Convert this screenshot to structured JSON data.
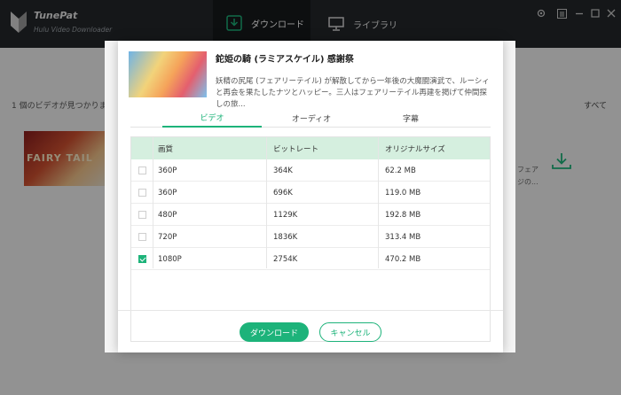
{
  "app": {
    "name": "TunePat",
    "subtitle": "Hulu Video Downloader"
  },
  "nav": {
    "download_label": "ダウンロード",
    "library_label": "ライブラリ"
  },
  "background": {
    "found_text": "1 個のビデオが見つかりま",
    "filter_label": "すべて",
    "thumb_text": "FAIRY TAIL",
    "snippet_line1": "フェア",
    "snippet_line2": "ジの..."
  },
  "modal": {
    "title": "鉈姫の騎 (ラミアスケイル) 感謝祭",
    "description": "妖精の尻尾 (フェアリーテイル) が解散してから一年後の大魔闘演武で、ルーシィと再会を果たしたナツとハッピー。三人はフェアリーテイル再建を掲げて仲間探しの旅...",
    "tabs": [
      {
        "label": "ビデオ",
        "active": true
      },
      {
        "label": "オーディオ",
        "active": false
      },
      {
        "label": "字幕",
        "active": false
      }
    ],
    "table": {
      "headers": [
        "画質",
        "ビットレート",
        "オリジナルサイズ"
      ],
      "rows": [
        {
          "quality": "360P",
          "bitrate": "364K",
          "size": "62.2 MB",
          "checked": false
        },
        {
          "quality": "360P",
          "bitrate": "696K",
          "size": "119.0 MB",
          "checked": false
        },
        {
          "quality": "480P",
          "bitrate": "1129K",
          "size": "192.8 MB",
          "checked": false
        },
        {
          "quality": "720P",
          "bitrate": "1836K",
          "size": "313.4 MB",
          "checked": false
        },
        {
          "quality": "1080P",
          "bitrate": "2754K",
          "size": "470.2 MB",
          "checked": true
        }
      ]
    },
    "download_button": "ダウンロード",
    "cancel_button": "キャンセル"
  },
  "colors": {
    "accent": "#1db37a",
    "topbar": "#24272b",
    "header_row": "#d5efdf"
  }
}
